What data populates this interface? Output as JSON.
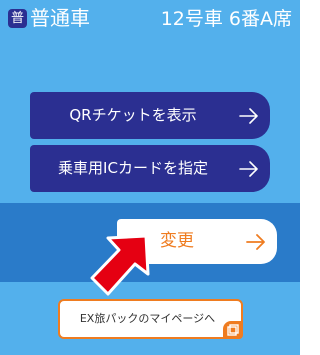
{
  "header": {
    "class_badge": "普",
    "class_label": "普通車",
    "seat": "12号車 6番A席"
  },
  "buttons": {
    "qr_ticket": "QRチケットを表示",
    "ic_card": "乗車用ICカードを指定",
    "change": "変更",
    "ex_mypage": "EX旅パックのマイページへ"
  },
  "icons": {
    "arrow": "arrow-right-icon",
    "pointer": "red-pointer-arrow-icon",
    "external": "external-window-icon"
  },
  "colors": {
    "background": "#53b0ec",
    "band": "#2a7bc9",
    "navy_button": "#2b2f91",
    "accent_orange": "#ef7c20",
    "pointer_red": "#e50012"
  }
}
